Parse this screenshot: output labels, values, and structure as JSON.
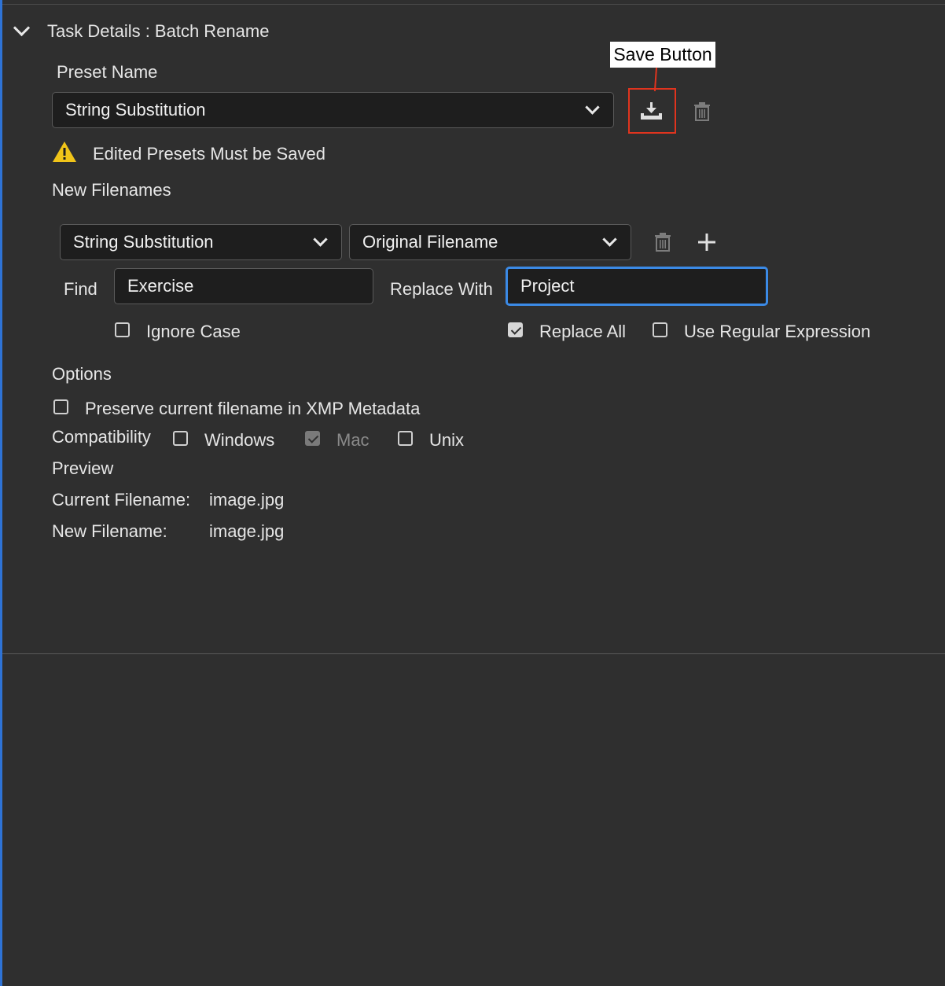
{
  "header": {
    "title": "Task Details : Batch Rename"
  },
  "preset": {
    "label": "Preset Name",
    "selected": "String Substitution",
    "warning": "Edited Presets Must be Saved"
  },
  "callout": {
    "text": "Save Button"
  },
  "new_filenames": {
    "label": "New Filenames",
    "type_selected": "String Substitution",
    "source_selected": "Original Filename",
    "find_label": "Find",
    "find_value": "Exercise",
    "replace_label": "Replace With",
    "replace_value": "Project",
    "ignore_case": {
      "label": "Ignore Case",
      "checked": false
    },
    "replace_all": {
      "label": "Replace All",
      "checked": true
    },
    "use_regex": {
      "label": "Use Regular Expression",
      "checked": false
    }
  },
  "options": {
    "label": "Options",
    "preserve": {
      "label": "Preserve current filename in XMP Metadata",
      "checked": false
    },
    "compatibility_label": "Compatibility",
    "windows": {
      "label": "Windows",
      "checked": false
    },
    "mac": {
      "label": "Mac",
      "checked": true,
      "disabled": true
    },
    "unix": {
      "label": "Unix",
      "checked": false
    }
  },
  "preview": {
    "label": "Preview",
    "current_label": "Current Filename:",
    "current_value": "image.jpg",
    "new_label": "New Filename:",
    "new_value": "image.jpg"
  },
  "colors": {
    "accent": "#2e73d6",
    "focus": "#3b8ae6",
    "callout_border": "#e0341e",
    "warning": "#f0c419"
  }
}
